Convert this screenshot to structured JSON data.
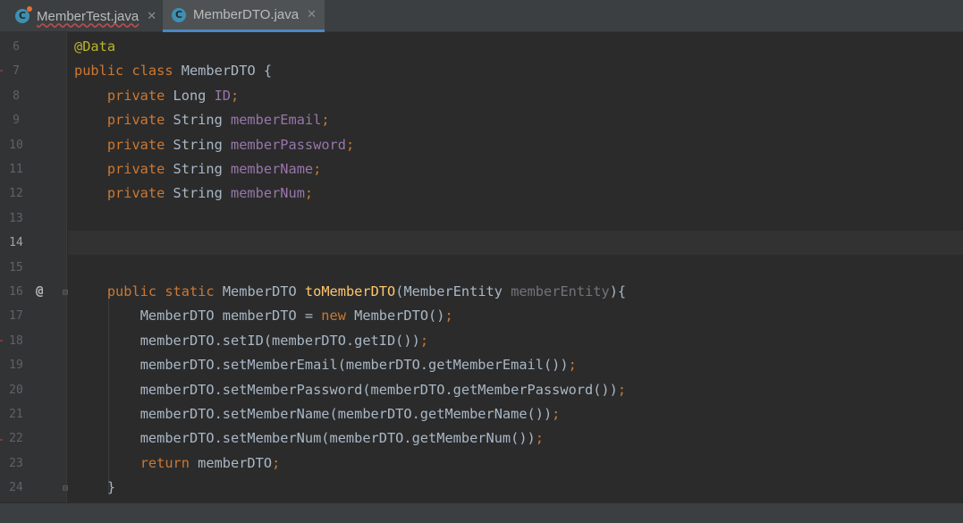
{
  "tabs": [
    {
      "label": "MemberTest.java",
      "icon": "class-c-icon",
      "has_error": true
    },
    {
      "label": "MemberDTO.java",
      "icon": "class-c-icon",
      "active": true
    }
  ],
  "close_glyph": "✕",
  "gutter": {
    "line_numbers": [
      "6",
      "7",
      "8",
      "9",
      "10",
      "11",
      "12",
      "13",
      "14",
      "15",
      "16",
      "17",
      "18",
      "19",
      "20",
      "21",
      "22",
      "23",
      "24"
    ],
    "current_line": "14",
    "override_marker": "@",
    "override_line": "16"
  },
  "colors": {
    "keyword": "#cc7832",
    "annotation": "#bbb529",
    "field": "#9876aa",
    "method_decl": "#ffc66d",
    "unused_param": "#72737a",
    "default_text": "#a9b7c6",
    "background": "#2b2b2b"
  },
  "code": {
    "l6": {
      "annotation": "@Data"
    },
    "l7": {
      "kw1": "public",
      "kw2": "class",
      "name": "MemberDTO",
      "brace": "{"
    },
    "l8": {
      "kw": "private",
      "type": "Long",
      "field": "ID",
      "semi": ";"
    },
    "l9": {
      "kw": "private",
      "type": "String",
      "field": "memberEmail",
      "semi": ";"
    },
    "l10": {
      "kw": "private",
      "type": "String",
      "field": "memberPassword",
      "semi": ";"
    },
    "l11": {
      "kw": "private",
      "type": "String",
      "field": "memberName",
      "semi": ";"
    },
    "l12": {
      "kw": "private",
      "type": "String",
      "field": "memberNum",
      "semi": ";"
    },
    "l16": {
      "kw1": "public",
      "kw2": "static",
      "ret": "MemberDTO",
      "method": "toMemberDTO",
      "open": "(",
      "ptype": "MemberEntity",
      "pname": "memberEntity",
      "close": "){"
    },
    "l17": {
      "pre": "MemberDTO memberDTO = ",
      "kw": "new",
      "post": " MemberDTO()",
      "semi": ";"
    },
    "l18": {
      "text": "memberDTO.setID(memberDTO.getID())",
      "semi": ";"
    },
    "l19": {
      "text": "memberDTO.setMemberEmail(memberDTO.getMemberEmail())",
      "semi": ";"
    },
    "l20": {
      "text": "memberDTO.setMemberPassword(memberDTO.getMemberPassword())",
      "semi": ";"
    },
    "l21": {
      "text": "memberDTO.setMemberName(memberDTO.getMemberName())",
      "semi": ";"
    },
    "l22": {
      "text": "memberDTO.setMemberNum(memberDTO.getMemberNum())",
      "semi": ";"
    },
    "l23": {
      "kw": "return",
      "text": " memberDTO",
      "semi": ";"
    },
    "l24": {
      "text": "}"
    }
  }
}
